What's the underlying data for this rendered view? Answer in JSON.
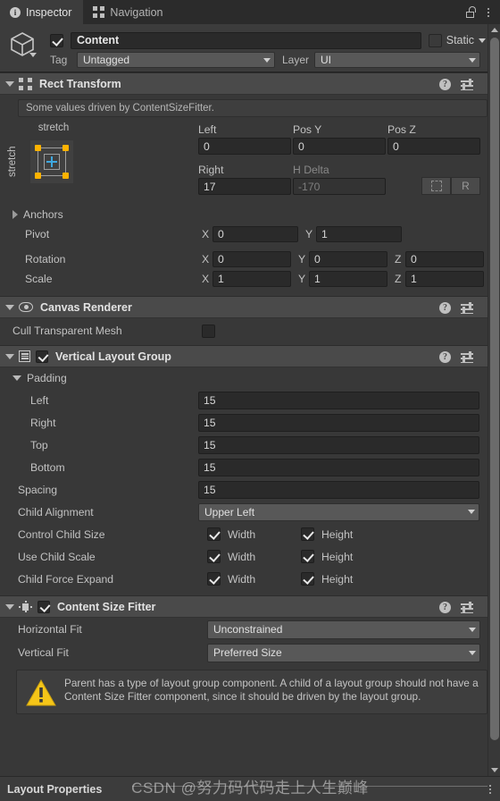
{
  "window": {
    "tabs": [
      {
        "label": "Inspector",
        "icon": "info-icon",
        "active": true
      },
      {
        "label": "Navigation",
        "icon": "navigation-icon",
        "active": false
      }
    ],
    "lock_icon": "lock-icon",
    "menu_icon": "kebab-menu-icon"
  },
  "gameobject": {
    "icon": "cube-icon",
    "enabled": true,
    "name": "Content",
    "static_label": "Static",
    "static_checked": false,
    "tag_label": "Tag",
    "tag_value": "Untagged",
    "layer_label": "Layer",
    "layer_value": "UI"
  },
  "components": [
    {
      "title": "Rect Transform",
      "icon": "rect-transform-icon",
      "expanded": true,
      "has_toggle": false,
      "help_icon": "help-icon",
      "preset_icon": "preset-icon",
      "menu_icon": "kebab-menu-icon",
      "info_text": "Some values driven by ContentSizeFitter.",
      "anchor_preset": {
        "top_label": "stretch",
        "left_label": "stretch"
      },
      "fields": {
        "left_label": "Left",
        "left_value": "0",
        "posy_label": "Pos Y",
        "posy_value": "0",
        "posz_label": "Pos Z",
        "posz_value": "0",
        "right_label": "Right",
        "right_value": "17",
        "hdelta_label": "H Delta",
        "hdelta_value": "-170",
        "blueprint_button": "blueprint-mode-button",
        "raw_button": "R"
      },
      "anchors_label": "Anchors",
      "pivot_label": "Pivot",
      "pivot": {
        "x": "0",
        "y": "1"
      },
      "rotation_label": "Rotation",
      "rotation": {
        "x": "0",
        "y": "0",
        "z": "0"
      },
      "scale_label": "Scale",
      "scale": {
        "x": "1",
        "y": "1",
        "z": "1"
      },
      "axis_x": "X",
      "axis_y": "Y",
      "axis_z": "Z"
    },
    {
      "title": "Canvas Renderer",
      "icon": "eye-icon",
      "expanded": true,
      "has_toggle": false,
      "cull_label": "Cull Transparent Mesh",
      "cull_checked": false
    },
    {
      "title": "Vertical Layout Group",
      "icon": "vertical-layout-icon",
      "expanded": true,
      "has_toggle": true,
      "enabled": true,
      "padding_label": "Padding",
      "padding": [
        {
          "label": "Left",
          "value": "15"
        },
        {
          "label": "Right",
          "value": "15"
        },
        {
          "label": "Top",
          "value": "15"
        },
        {
          "label": "Bottom",
          "value": "15"
        }
      ],
      "spacing_label": "Spacing",
      "spacing_value": "15",
      "child_alignment_label": "Child Alignment",
      "child_alignment_value": "Upper Left",
      "toggle_rows": [
        {
          "label": "Control Child Size",
          "width_label": "Width",
          "width_checked": true,
          "height_label": "Height",
          "height_checked": true
        },
        {
          "label": "Use Child Scale",
          "width_label": "Width",
          "width_checked": true,
          "height_label": "Height",
          "height_checked": true
        },
        {
          "label": "Child Force Expand",
          "width_label": "Width",
          "width_checked": true,
          "height_label": "Height",
          "height_checked": true
        }
      ]
    },
    {
      "title": "Content Size Fitter",
      "icon": "content-size-fitter-icon",
      "expanded": true,
      "has_toggle": true,
      "enabled": true,
      "horizontal_fit_label": "Horizontal Fit",
      "horizontal_fit_value": "Unconstrained",
      "vertical_fit_label": "Vertical Fit",
      "vertical_fit_value": "Preferred Size",
      "warning_icon": "warning-triangle-icon",
      "warning_text": "Parent has a type of layout group component. A child of a layout group should not have a Content Size Fitter component, since it should be driven by the layout group."
    }
  ],
  "bottom": {
    "title": "Layout Properties",
    "menu_icon": "kebab-menu-icon"
  },
  "watermark": "CSDN @努力码代码走上人生巅峰",
  "colors": {
    "background": "#383838",
    "header": "#4a4a4a",
    "field": "#2a2a2a",
    "accent_anchor": "#ffb300",
    "accent_cross": "#3ea8e0",
    "warning": "#f5c518"
  }
}
